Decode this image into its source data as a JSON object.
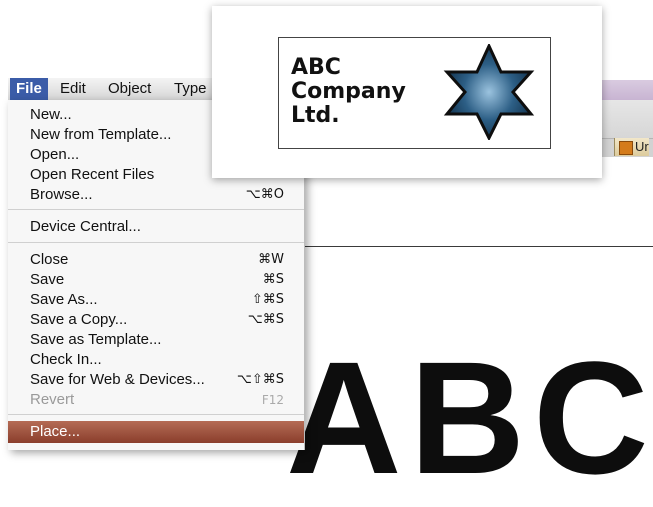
{
  "menubar": {
    "items": [
      "File",
      "Edit",
      "Object",
      "Type"
    ]
  },
  "file_menu": [
    {
      "label": "New...",
      "shortcut": ""
    },
    {
      "label": "New from Template...",
      "shortcut": ""
    },
    {
      "label": "Open...",
      "shortcut": ""
    },
    {
      "label": "Open Recent Files",
      "shortcut": ""
    },
    {
      "label": "Browse...",
      "shortcut": "⌥⌘O"
    },
    {
      "label": "Device Central...",
      "shortcut": ""
    },
    {
      "label": "Close",
      "shortcut": "⌘W"
    },
    {
      "label": "Save",
      "shortcut": "⌘S"
    },
    {
      "label": "Save As...",
      "shortcut": "⇧⌘S"
    },
    {
      "label": "Save a Copy...",
      "shortcut": "⌥⌘S"
    },
    {
      "label": "Save as Template...",
      "shortcut": ""
    },
    {
      "label": "Check In...",
      "shortcut": ""
    },
    {
      "label": "Save for Web & Devices...",
      "shortcut": "⌥⇧⌘S"
    },
    {
      "label": "Revert",
      "shortcut": "F12"
    },
    {
      "label": "Place...",
      "shortcut": ""
    }
  ],
  "logo": {
    "line1": "ABC",
    "line2": "Company",
    "line3": "Ltd.",
    "icon": "six-point-star-icon",
    "star_color": "#2d5f86"
  },
  "tab": {
    "label": "Ur"
  },
  "canvas_text": "ABC",
  "colors": {
    "menu_highlight": "#9b4c38",
    "menubar_active": "#3b5ca8"
  }
}
